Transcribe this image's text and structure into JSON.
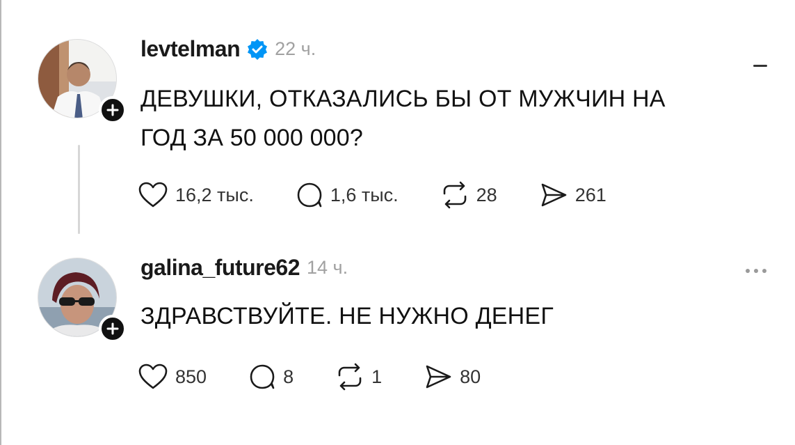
{
  "posts": [
    {
      "username": "levtelman",
      "verified": true,
      "time": "22 ч.",
      "text_lines": [
        "ДЕВУШКИ, ОТКАЗАЛИСЬ БЫ ОТ МУЖЧИН НА",
        "ГОД ЗА 50 000 000?"
      ],
      "likes": "16,2 тыс.",
      "comments": "1,6 тыс.",
      "reposts": "28",
      "shares": "261",
      "avatar_icon": "man-in-suit-avatar",
      "follow_icon": "plus-icon"
    },
    {
      "username": "galina_future62",
      "verified": false,
      "time": "14 ч.",
      "text_lines": [
        "ЗДРАВСТВУЙТЕ. НЕ НУЖНО ДЕНЕГ"
      ],
      "likes": "850",
      "comments": "8",
      "reposts": "1",
      "shares": "80",
      "avatar_icon": "woman-with-sunglasses-avatar",
      "follow_icon": "plus-icon"
    }
  ],
  "icons": {
    "like": "heart-icon",
    "comment": "comment-bubble-icon",
    "repost": "repost-arrows-icon",
    "share": "paper-plane-icon",
    "more": "more-dots-icon",
    "verified": "verified-badge-icon"
  },
  "colors": {
    "text": "#111111",
    "muted": "#a1a1a1",
    "verified": "#0095f6",
    "thread_line": "#d7d7d7",
    "background": "#ffffff"
  }
}
